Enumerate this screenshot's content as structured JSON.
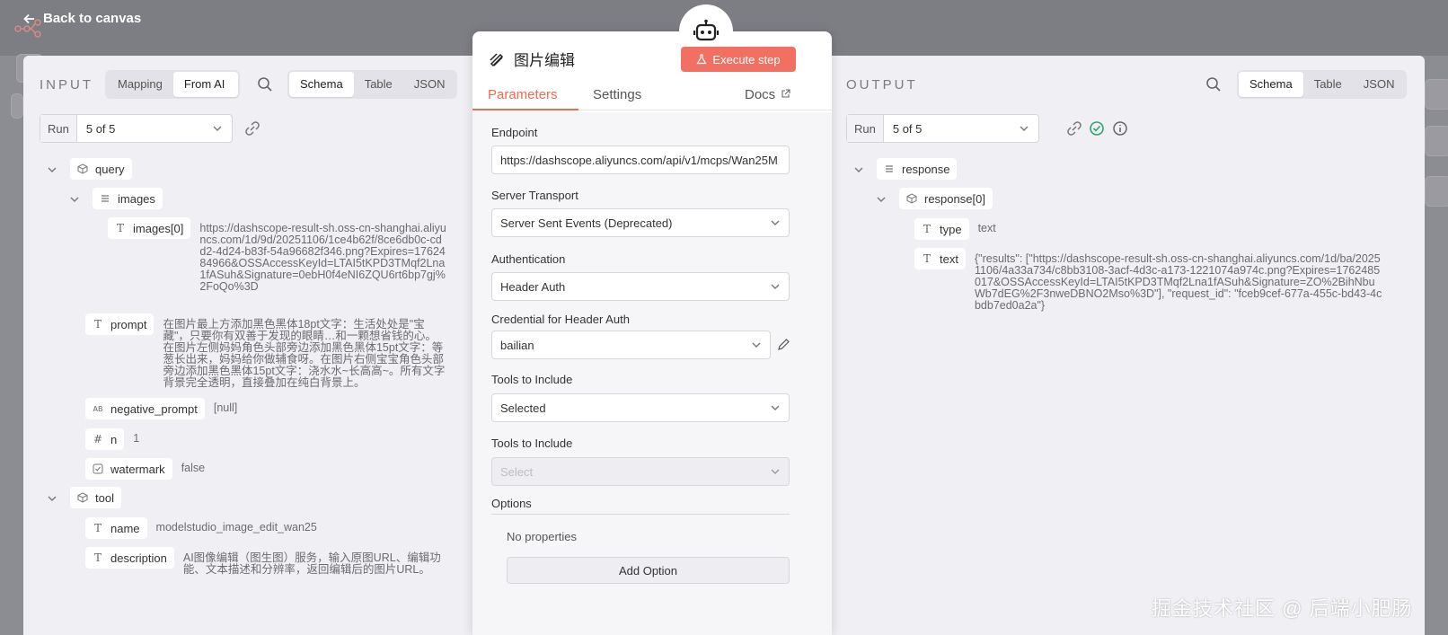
{
  "nav": {
    "back_label": "Back to canvas"
  },
  "input": {
    "title": "INPUT",
    "mode_tabs": [
      "Mapping",
      "From AI"
    ],
    "view_tabs": [
      "Schema",
      "Table",
      "JSON"
    ],
    "run_label": "Run",
    "run_value": "5 of 5",
    "tree": {
      "query": "query",
      "images": "images",
      "images0_key": "images[0]",
      "images0_val": "https://dashscope-result-sh.oss-cn-shanghai.aliyuncs.com/1d/9d/20251106/1ce4b62f/8ce6db0c-cdd2-4d24-b83f-54a96682f346.png?Expires=1762484966&OSSAccessKeyId=LTAI5tKPD3TMqf2Lna1fASuh&Signature=0ebH0f4eNI6ZQU6rt6bp7gj%2FoQo%3D",
      "prompt_key": "prompt",
      "prompt_val": "在图片最上方添加黑色黑体18pt文字：生活处处是\"宝藏\"，只要你有双善于发现的眼睛…和一颗想省钱的心。在图片左侧妈妈角色头部旁边添加黑色黑体15pt文字：等葱长出来，妈妈给你做辅食呀。在图片右侧宝宝角色头部旁边添加黑色黑体15pt文字：浇水水~长高高~。所有文字背景完全透明，直接叠加在纯白背景上。",
      "neg_key": "negative_prompt",
      "neg_val": "[null]",
      "n_key": "n",
      "n_val": "1",
      "wm_key": "watermark",
      "wm_val": "false",
      "tool": "tool",
      "name_key": "name",
      "name_val": "modelstudio_image_edit_wan25",
      "desc_key": "description",
      "desc_val": "AI图像编辑（图生图）服务，输入原图URL、编辑功能、文本描述和分辨率，返回编辑后的图片URL。"
    }
  },
  "node": {
    "title": "图片编辑",
    "execute_label": "Execute step",
    "tabs": [
      "Parameters",
      "Settings",
      "Docs"
    ],
    "fields": {
      "endpoint_label": "Endpoint",
      "endpoint_value": "https://dashscope.aliyuncs.com/api/v1/mcps/Wan25M",
      "transport_label": "Server Transport",
      "transport_value": "Server Sent Events (Deprecated)",
      "auth_label": "Authentication",
      "auth_value": "Header Auth",
      "cred_label": "Credential for Header Auth",
      "cred_value": "bailian",
      "tools_label": "Tools to Include",
      "tools_value": "Selected",
      "tools2_label": "Tools to Include",
      "tools2_placeholder": "Select",
      "options_label": "Options",
      "no_props": "No properties",
      "add_option": "Add Option"
    }
  },
  "output": {
    "title": "OUTPUT",
    "view_tabs": [
      "Schema",
      "Table",
      "JSON"
    ],
    "run_label": "Run",
    "run_value": "5 of 5",
    "tree": {
      "response": "response",
      "response0": "response[0]",
      "type_key": "type",
      "type_val": "text",
      "text_key": "text",
      "text_val": "{\"results\": [\"https://dashscope-result-sh.oss-cn-shanghai.aliyuncs.com/1d/ba/20251106/4a33a734/c8bb3108-3acf-4d3c-a173-1221074a974c.png?Expires=1762485017&OSSAccessKeyId=LTAI5tKPD3TMqf2Lna1fASuh&Signature=ZO%2BihNbuWb7dEG%2F3nweDBNO2Mso%3D\"], \"request_id\": \"fceb9cef-677a-455c-bd43-4cbdb7ed0a2a\"}"
    }
  },
  "watermark": "掘金技术社区 @ 后端小肥肠",
  "colors": {
    "accent": "#f06a52",
    "execute": "#f27062",
    "success": "#2fa36b"
  },
  "icons": [
    "arrow-left-icon",
    "pen-icon",
    "flask-icon",
    "robot-icon",
    "external-link-icon",
    "search-icon",
    "link-icon",
    "check-circle-icon",
    "info-icon",
    "chevron-down-icon",
    "cube-icon",
    "list-icon",
    "text-type-icon",
    "string-type-icon",
    "hash-icon",
    "checkbox-icon",
    "pencil-icon"
  ]
}
